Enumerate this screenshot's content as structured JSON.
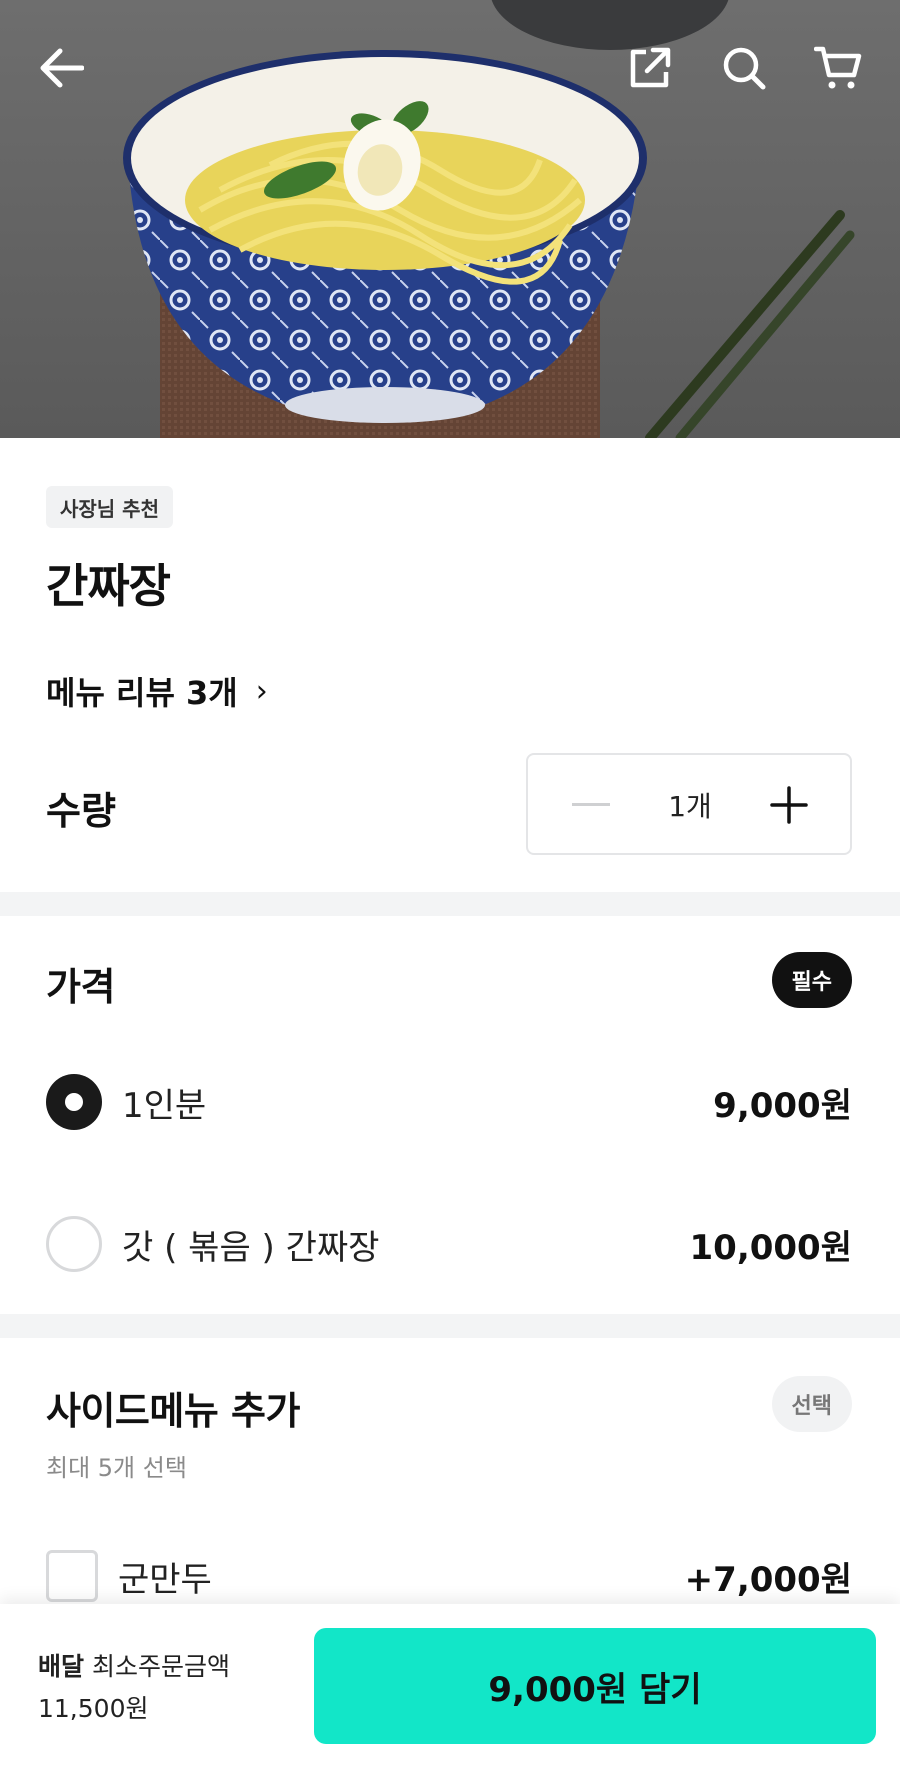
{
  "header": {
    "back_icon": "arrow-left-icon",
    "share_icon": "share-icon",
    "search_icon": "search-icon",
    "cart_icon": "cart-icon"
  },
  "menu": {
    "badge": "사장님 추천",
    "name": "간짜장",
    "review_link": "메뉴 리뷰 3개",
    "review_chevron": "›"
  },
  "quantity": {
    "label": "수량",
    "value": "1개",
    "minus_icon": "minus-icon",
    "plus_icon": "plus-icon"
  },
  "price_section": {
    "title": "가격",
    "badge": "필수",
    "options": [
      {
        "label": "1인분",
        "price": "9,000원",
        "selected": true
      },
      {
        "label": "갓 ( 볶음 ) 간짜장",
        "price": "10,000원",
        "selected": false
      }
    ]
  },
  "side_section": {
    "title": "사이드메뉴 추가",
    "badge": "선택",
    "note": "최대 5개 선택",
    "options": [
      {
        "label": "군만두",
        "price": "+7,000원",
        "checked": false
      }
    ]
  },
  "bottom_bar": {
    "delivery_label": "배달",
    "min_order_label": "최소주문금액",
    "min_order_value": "11,500원",
    "cart_button": "9,000원 담기"
  },
  "colors": {
    "accent": "#12e6c8",
    "dark": "#111111",
    "divider": "#f3f4f5"
  }
}
